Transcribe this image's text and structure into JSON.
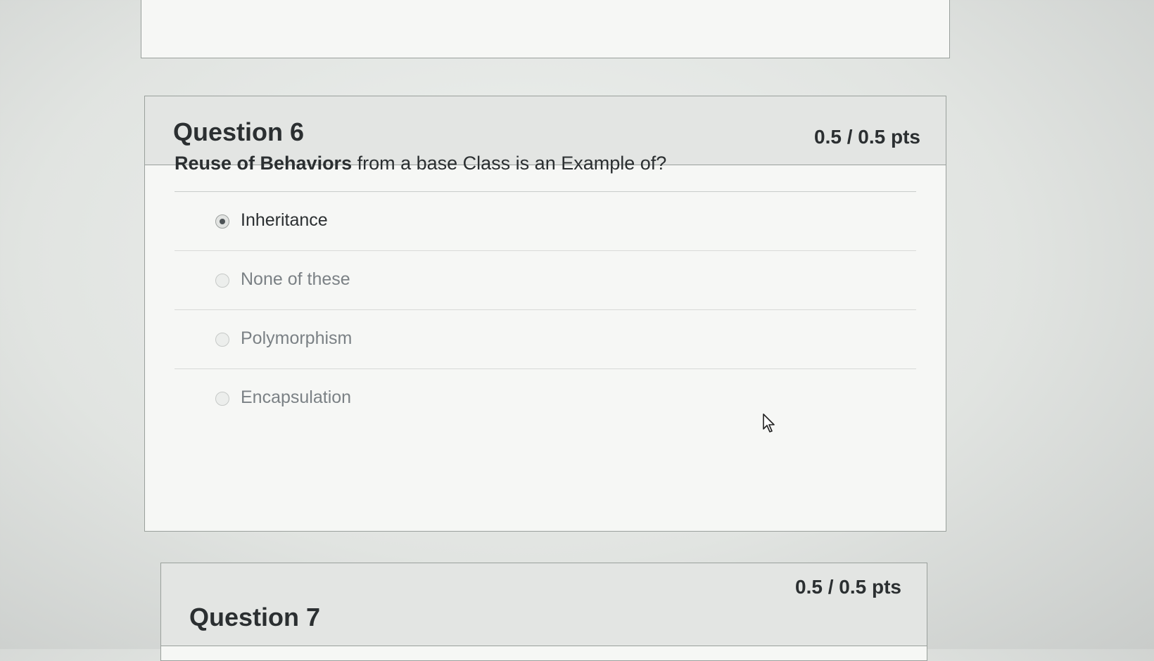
{
  "question6": {
    "title": "Question 6",
    "points": "0.5 / 0.5 pts",
    "text_bold": "Reuse of Behaviors",
    "text_rest": " from a base Class is an Example of?",
    "answers": [
      {
        "label": "Inheritance",
        "selected": true
      },
      {
        "label": "None of these",
        "selected": false
      },
      {
        "label": "Polymorphism",
        "selected": false
      },
      {
        "label": "Encapsulation",
        "selected": false
      }
    ]
  },
  "question7": {
    "title": "Question 7",
    "points": "0.5 / 0.5 pts"
  }
}
